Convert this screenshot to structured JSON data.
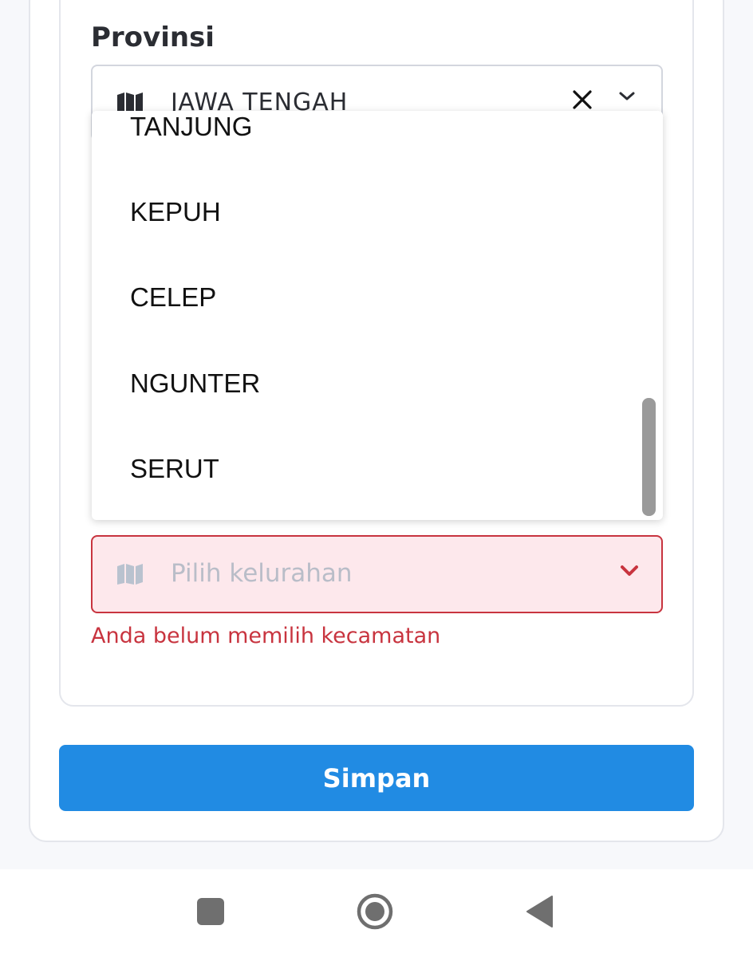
{
  "form": {
    "provinsi_label": "Provinsi",
    "provinsi_value": "JAWA TENGAH",
    "dropdown_options": [
      "TANJUNG",
      "KEPUH",
      "CELEP",
      "NGUNTER",
      "SERUT"
    ],
    "kelurahan_placeholder": "Pilih kelurahan",
    "error_message": "Anda belum memilih kecamatan",
    "save_label": "Simpan"
  },
  "colors": {
    "primary": "#218be3",
    "error": "#c8343f",
    "error_bg": "#fde8ec",
    "text": "#2b2d33",
    "placeholder": "#b9bdc8"
  },
  "icons": {
    "provinsi_icon": "map-icon",
    "kelurahan_icon": "map-icon",
    "clear": "close-icon",
    "expand": "chevron-down-icon",
    "nav_recents": "square-icon",
    "nav_home": "circle-icon",
    "nav_back": "triangle-back-icon"
  }
}
